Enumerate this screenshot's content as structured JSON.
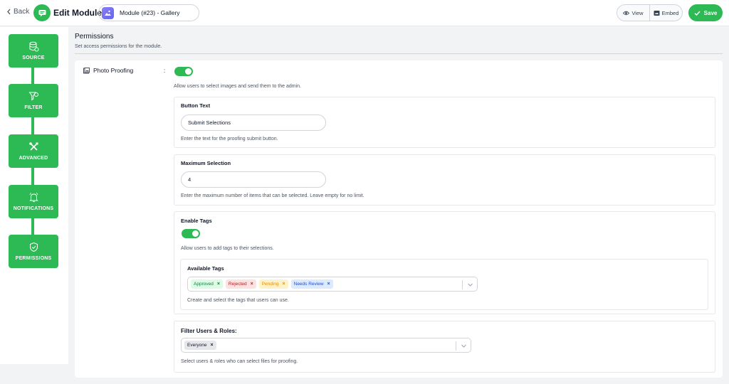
{
  "header": {
    "back_label": "Back",
    "title": "Edit Module",
    "module_name": "Module (#23) - Gallery",
    "view_label": "View",
    "embed_label": "Embed",
    "save_label": "Save"
  },
  "sidebar": {
    "items": [
      {
        "label": "SOURCE",
        "icon": "database-icon"
      },
      {
        "label": "FILTER",
        "icon": "filter-icon"
      },
      {
        "label": "ADVANCED",
        "icon": "tools-icon"
      },
      {
        "label": "NOTIFICATIONS",
        "icon": "bell-icon"
      },
      {
        "label": "PERMISSIONS",
        "icon": "shield-check-icon"
      }
    ]
  },
  "permissions": {
    "title": "Permissions",
    "subtitle": "Set access permissions for the module."
  },
  "photo_proofing": {
    "label": "Photo Proofing",
    "separator": ":",
    "enabled": true,
    "help": "Allow users to select images and send them to the admin."
  },
  "button_text": {
    "label": "Button Text",
    "value": "Submit Selections",
    "help": "Enter the text for the proofing submit button."
  },
  "maximum_selection": {
    "label": "Maximum Selection",
    "value": "4",
    "help": "Enter the maximum number of items that can be selected. Leave empty for no limit."
  },
  "enable_tags": {
    "label": "Enable Tags",
    "enabled": true,
    "help": "Allow users to add tags to their selections."
  },
  "available_tags": {
    "label": "Available Tags",
    "tags": [
      {
        "label": "Approved",
        "text_color": "#15803d",
        "bg_color": "#dcfce7"
      },
      {
        "label": "Rejected",
        "text_color": "#b91c1c",
        "bg_color": "#fee2e2"
      },
      {
        "label": "Pending",
        "text_color": "#ea8a0c",
        "bg_color": "#fef3c7"
      },
      {
        "label": "Needs Review",
        "text_color": "#1d4ed8",
        "bg_color": "#dbeafe"
      }
    ],
    "remove_symbol": "×",
    "help": "Create and select the tags that users can use."
  },
  "filter_users": {
    "label": "Filter Users & Roles:",
    "selected": [
      {
        "label": "Everyone"
      }
    ],
    "remove_symbol": "×",
    "help": "Select users & roles who can select files for proofing."
  },
  "colors": {
    "accent": "#2db954",
    "page_bg": "#f2f3f5"
  }
}
